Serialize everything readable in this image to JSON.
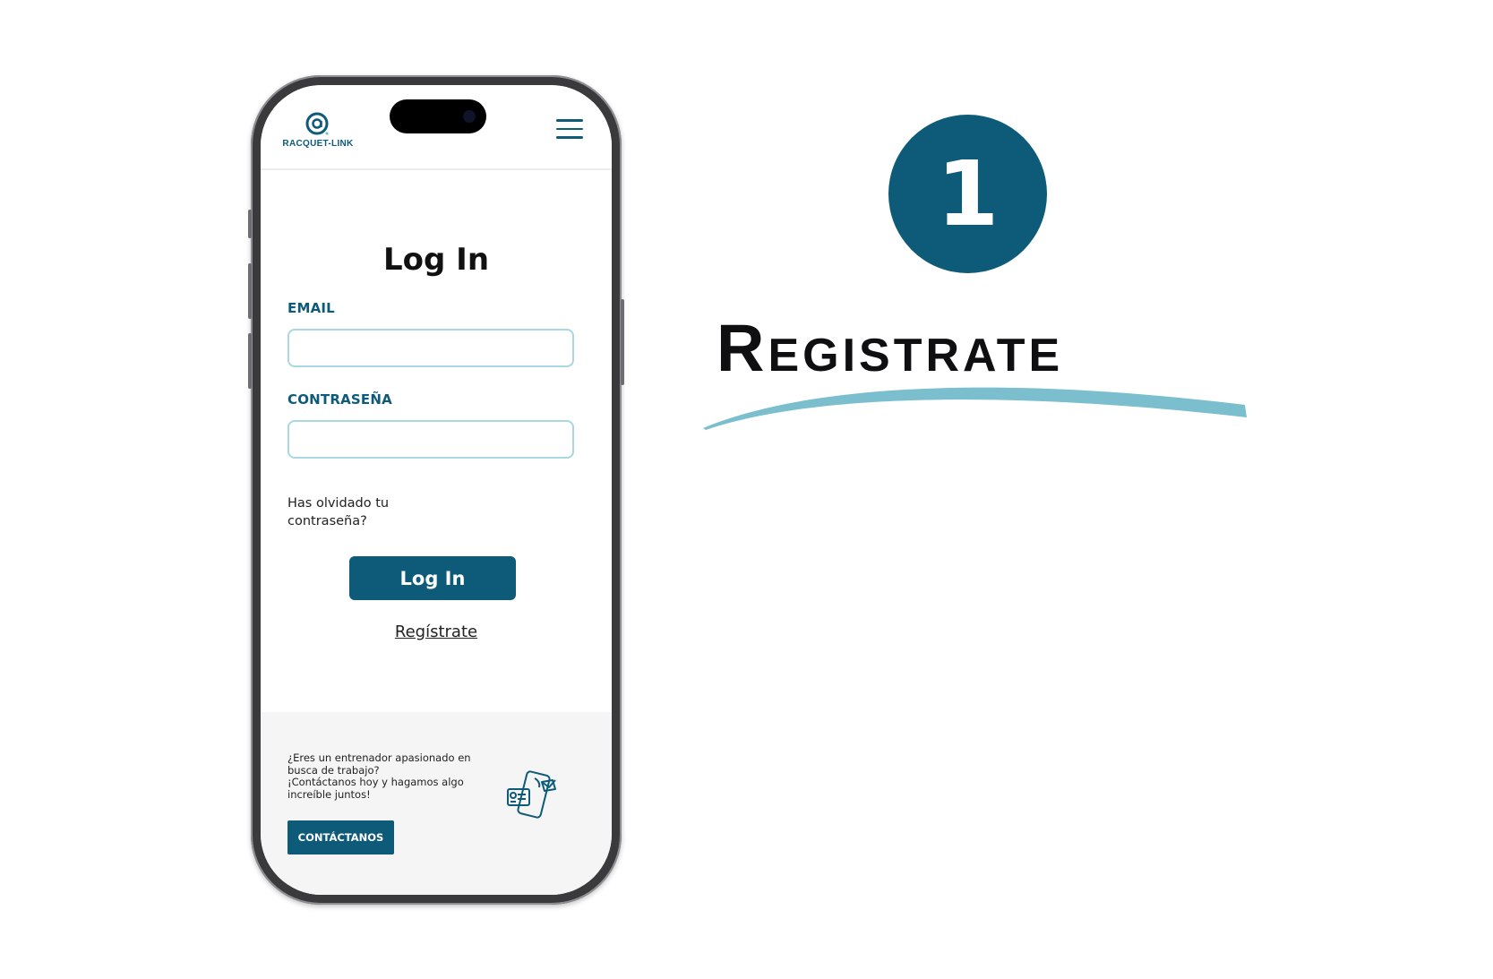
{
  "app": {
    "logo_text": "RACQUET-LINK",
    "login_title": "Log In",
    "email_label": "EMAIL",
    "email_value": "",
    "password_label": "CONTRASEÑA",
    "password_value": "",
    "forgot_password": "Has olvidado tu contraseña?",
    "login_button": "Log In",
    "register_link": "Regístrate"
  },
  "footer": {
    "lines": [
      "¿Eres un entrenador apasionado en",
      "busca de trabajo?",
      "¡Contáctanos hoy y hagamos algo",
      "increíble juntos!"
    ],
    "contact_button": "CONTÁCTANOS"
  },
  "step": {
    "number": "1",
    "title": "Registrate"
  },
  "colors": {
    "brand": "#0d5a79",
    "input_border": "#a9d7e4",
    "swoosh": "#7bbfcf"
  },
  "icons": [
    "racquet-link-logo-icon",
    "hamburger-menu-icon",
    "phone-contact-illustration-icon"
  ]
}
